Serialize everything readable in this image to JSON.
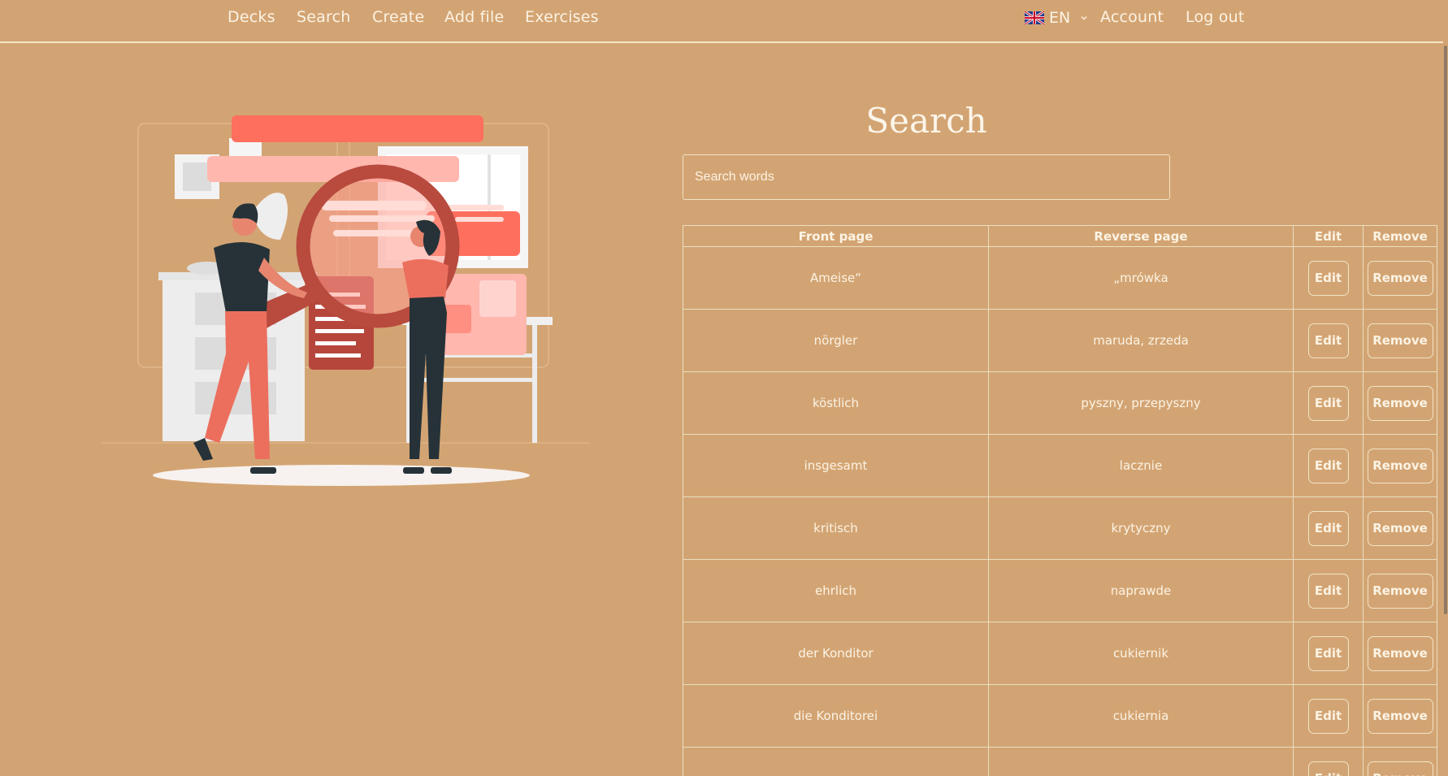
{
  "nav": {
    "links": [
      "Decks",
      "Search",
      "Create",
      "Add file",
      "Exercises"
    ],
    "language": {
      "code": "EN",
      "flag_icon": "uk-flag-icon"
    },
    "account_label": "Account",
    "logout_label": "Log out"
  },
  "search": {
    "title": "Search",
    "placeholder": "Search words"
  },
  "table": {
    "headers": {
      "front": "Front page",
      "reverse": "Reverse page",
      "edit": "Edit",
      "remove": "Remove"
    },
    "rows": [
      {
        "front": "Ameise“",
        "reverse": "„mrówka",
        "edit": "Edit",
        "remove": "Remove"
      },
      {
        "front": "nörgler",
        "reverse": "maruda, zrzeda",
        "edit": "Edit",
        "remove": "Remove"
      },
      {
        "front": "köstlich",
        "reverse": "pyszny, przepyszny",
        "edit": "Edit",
        "remove": "Remove"
      },
      {
        "front": "insgesamt",
        "reverse": "lacznie",
        "edit": "Edit",
        "remove": "Remove"
      },
      {
        "front": "kritisch",
        "reverse": "krytyczny",
        "edit": "Edit",
        "remove": "Remove"
      },
      {
        "front": "ehrlich",
        "reverse": "naprawde",
        "edit": "Edit",
        "remove": "Remove"
      },
      {
        "front": "der Konditor",
        "reverse": "cukiernik",
        "edit": "Edit",
        "remove": "Remove"
      },
      {
        "front": "die Konditorei",
        "reverse": "cukiernia",
        "edit": "Edit",
        "remove": "Remove"
      },
      {
        "front": "",
        "reverse": "",
        "edit": "Edit",
        "remove": "Remove"
      }
    ]
  },
  "colors": {
    "background": "#d3a473",
    "text": "#fbf3e4",
    "border": "#e8dfc0",
    "accent": "#ec6f5e"
  }
}
